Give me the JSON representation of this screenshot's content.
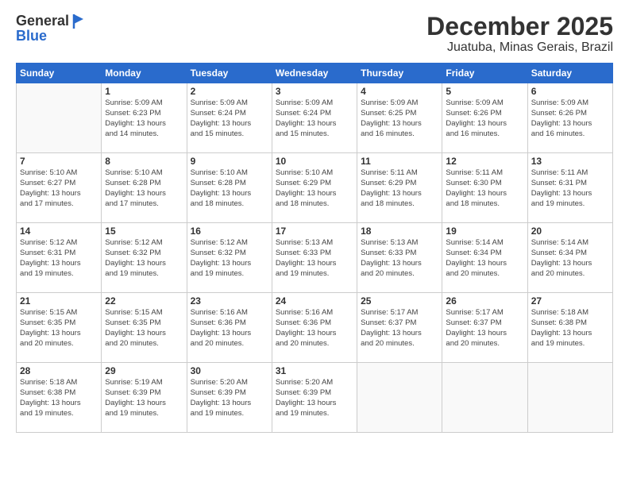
{
  "header": {
    "logo_general": "General",
    "logo_blue": "Blue",
    "month": "December 2025",
    "location": "Juatuba, Minas Gerais, Brazil"
  },
  "weekdays": [
    "Sunday",
    "Monday",
    "Tuesday",
    "Wednesday",
    "Thursday",
    "Friday",
    "Saturday"
  ],
  "weeks": [
    [
      {
        "date": "",
        "info": ""
      },
      {
        "date": "1",
        "info": "Sunrise: 5:09 AM\nSunset: 6:23 PM\nDaylight: 13 hours\nand 14 minutes."
      },
      {
        "date": "2",
        "info": "Sunrise: 5:09 AM\nSunset: 6:24 PM\nDaylight: 13 hours\nand 15 minutes."
      },
      {
        "date": "3",
        "info": "Sunrise: 5:09 AM\nSunset: 6:24 PM\nDaylight: 13 hours\nand 15 minutes."
      },
      {
        "date": "4",
        "info": "Sunrise: 5:09 AM\nSunset: 6:25 PM\nDaylight: 13 hours\nand 16 minutes."
      },
      {
        "date": "5",
        "info": "Sunrise: 5:09 AM\nSunset: 6:26 PM\nDaylight: 13 hours\nand 16 minutes."
      },
      {
        "date": "6",
        "info": "Sunrise: 5:09 AM\nSunset: 6:26 PM\nDaylight: 13 hours\nand 16 minutes."
      }
    ],
    [
      {
        "date": "7",
        "info": "Sunrise: 5:10 AM\nSunset: 6:27 PM\nDaylight: 13 hours\nand 17 minutes."
      },
      {
        "date": "8",
        "info": "Sunrise: 5:10 AM\nSunset: 6:28 PM\nDaylight: 13 hours\nand 17 minutes."
      },
      {
        "date": "9",
        "info": "Sunrise: 5:10 AM\nSunset: 6:28 PM\nDaylight: 13 hours\nand 18 minutes."
      },
      {
        "date": "10",
        "info": "Sunrise: 5:10 AM\nSunset: 6:29 PM\nDaylight: 13 hours\nand 18 minutes."
      },
      {
        "date": "11",
        "info": "Sunrise: 5:11 AM\nSunset: 6:29 PM\nDaylight: 13 hours\nand 18 minutes."
      },
      {
        "date": "12",
        "info": "Sunrise: 5:11 AM\nSunset: 6:30 PM\nDaylight: 13 hours\nand 18 minutes."
      },
      {
        "date": "13",
        "info": "Sunrise: 5:11 AM\nSunset: 6:31 PM\nDaylight: 13 hours\nand 19 minutes."
      }
    ],
    [
      {
        "date": "14",
        "info": "Sunrise: 5:12 AM\nSunset: 6:31 PM\nDaylight: 13 hours\nand 19 minutes."
      },
      {
        "date": "15",
        "info": "Sunrise: 5:12 AM\nSunset: 6:32 PM\nDaylight: 13 hours\nand 19 minutes."
      },
      {
        "date": "16",
        "info": "Sunrise: 5:12 AM\nSunset: 6:32 PM\nDaylight: 13 hours\nand 19 minutes."
      },
      {
        "date": "17",
        "info": "Sunrise: 5:13 AM\nSunset: 6:33 PM\nDaylight: 13 hours\nand 19 minutes."
      },
      {
        "date": "18",
        "info": "Sunrise: 5:13 AM\nSunset: 6:33 PM\nDaylight: 13 hours\nand 20 minutes."
      },
      {
        "date": "19",
        "info": "Sunrise: 5:14 AM\nSunset: 6:34 PM\nDaylight: 13 hours\nand 20 minutes."
      },
      {
        "date": "20",
        "info": "Sunrise: 5:14 AM\nSunset: 6:34 PM\nDaylight: 13 hours\nand 20 minutes."
      }
    ],
    [
      {
        "date": "21",
        "info": "Sunrise: 5:15 AM\nSunset: 6:35 PM\nDaylight: 13 hours\nand 20 minutes."
      },
      {
        "date": "22",
        "info": "Sunrise: 5:15 AM\nSunset: 6:35 PM\nDaylight: 13 hours\nand 20 minutes."
      },
      {
        "date": "23",
        "info": "Sunrise: 5:16 AM\nSunset: 6:36 PM\nDaylight: 13 hours\nand 20 minutes."
      },
      {
        "date": "24",
        "info": "Sunrise: 5:16 AM\nSunset: 6:36 PM\nDaylight: 13 hours\nand 20 minutes."
      },
      {
        "date": "25",
        "info": "Sunrise: 5:17 AM\nSunset: 6:37 PM\nDaylight: 13 hours\nand 20 minutes."
      },
      {
        "date": "26",
        "info": "Sunrise: 5:17 AM\nSunset: 6:37 PM\nDaylight: 13 hours\nand 20 minutes."
      },
      {
        "date": "27",
        "info": "Sunrise: 5:18 AM\nSunset: 6:38 PM\nDaylight: 13 hours\nand 19 minutes."
      }
    ],
    [
      {
        "date": "28",
        "info": "Sunrise: 5:18 AM\nSunset: 6:38 PM\nDaylight: 13 hours\nand 19 minutes."
      },
      {
        "date": "29",
        "info": "Sunrise: 5:19 AM\nSunset: 6:39 PM\nDaylight: 13 hours\nand 19 minutes."
      },
      {
        "date": "30",
        "info": "Sunrise: 5:20 AM\nSunset: 6:39 PM\nDaylight: 13 hours\nand 19 minutes."
      },
      {
        "date": "31",
        "info": "Sunrise: 5:20 AM\nSunset: 6:39 PM\nDaylight: 13 hours\nand 19 minutes."
      },
      {
        "date": "",
        "info": ""
      },
      {
        "date": "",
        "info": ""
      },
      {
        "date": "",
        "info": ""
      }
    ]
  ]
}
